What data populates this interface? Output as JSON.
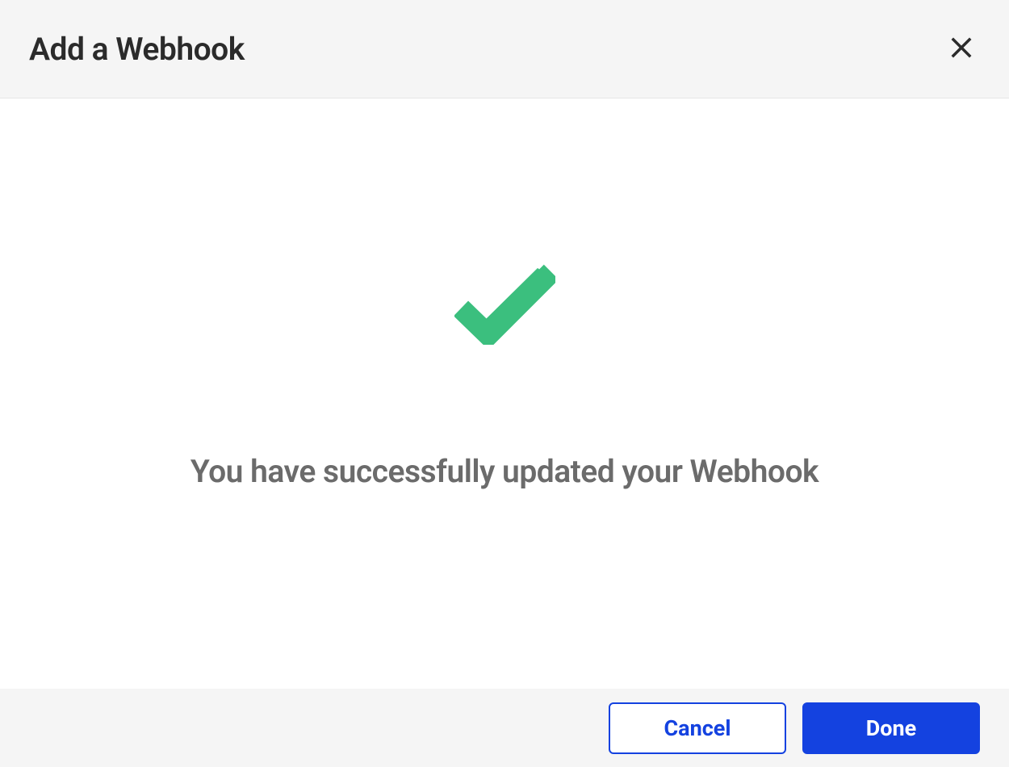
{
  "header": {
    "title": "Add a Webhook"
  },
  "body": {
    "success_message": "You have successfully updated your Webhook"
  },
  "footer": {
    "cancel_label": "Cancel",
    "done_label": "Done"
  },
  "colors": {
    "primary": "#1442e0",
    "success": "#3bbf7e",
    "header_bg": "#f5f5f5",
    "text_dark": "#2b2b2b",
    "text_muted": "#6b6b6b"
  }
}
